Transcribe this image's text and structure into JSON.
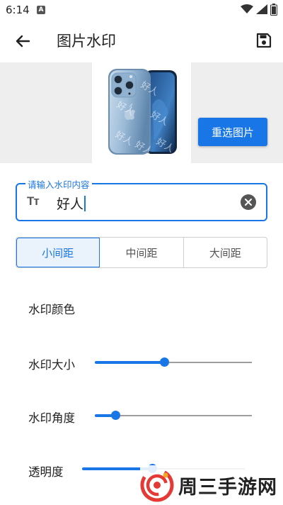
{
  "status": {
    "time": "6:14",
    "notification": "A"
  },
  "appbar": {
    "title": "图片水印"
  },
  "preview": {
    "reselect_label": "重选图片",
    "watermark_text": "好人"
  },
  "input": {
    "label": "请输入水印内容",
    "value": "好人",
    "text_icon": "Tт"
  },
  "spacing": {
    "options": [
      "小间距",
      "中间距",
      "大间距"
    ],
    "selected": 0
  },
  "settings": {
    "color_label": "水印颜色",
    "size_label": "水印大小",
    "size_value": 0.44,
    "angle_label": "水印角度",
    "angle_value": 0.13,
    "opacity_label": "透明度",
    "opacity_value": 0.43
  },
  "brand_watermark": {
    "text": "周三手游网"
  },
  "colors": {
    "accent": "#1976e6"
  }
}
